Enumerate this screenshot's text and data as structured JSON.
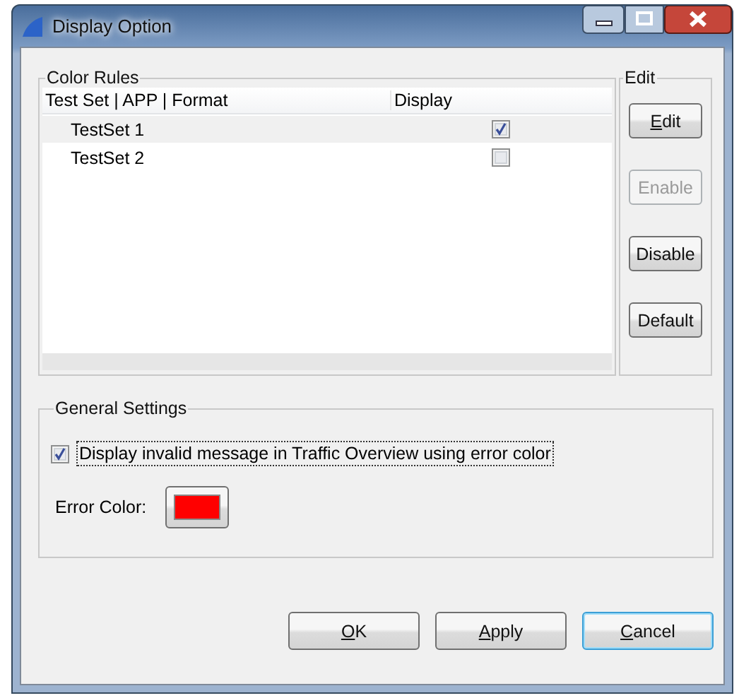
{
  "window": {
    "title": "Display Option"
  },
  "color_rules": {
    "title": "Color Rules",
    "columns": [
      "Test Set | APP | Format",
      "Display"
    ],
    "rows": [
      {
        "name": "TestSet 1",
        "display": true,
        "selected": true
      },
      {
        "name": "TestSet 2",
        "display": false,
        "selected": false
      }
    ]
  },
  "edit_group": {
    "title": "Edit",
    "buttons": [
      {
        "label": "Edit",
        "disabled": false,
        "underline_first": true
      },
      {
        "label": "Enable",
        "disabled": true,
        "underline_first": false
      },
      {
        "label": "Disable",
        "disabled": false,
        "underline_first": false
      },
      {
        "label": "Default",
        "disabled": false,
        "underline_first": false
      }
    ]
  },
  "general_settings": {
    "title": "General Settings",
    "option": {
      "label": "Display invalid message in Traffic Overview using error color",
      "checked": true,
      "focused": true
    },
    "error_color": {
      "label": "Error Color:",
      "color": "#ff0000"
    }
  },
  "buttons": [
    {
      "label": "OK",
      "underline_first": true,
      "default": false
    },
    {
      "label": "Apply",
      "underline_first": true,
      "default": false
    },
    {
      "label": "Cancel",
      "underline_first": true,
      "default": true
    }
  ]
}
